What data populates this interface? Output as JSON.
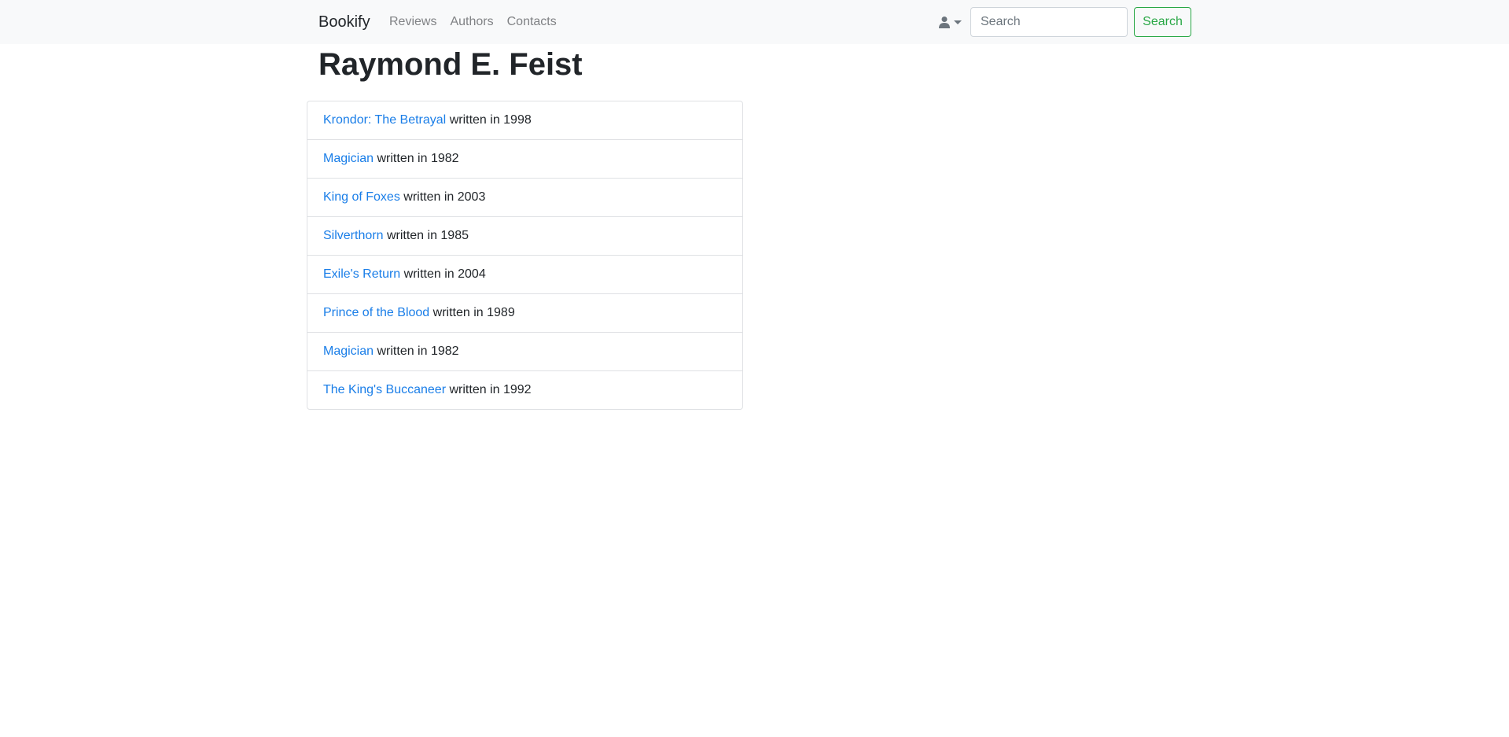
{
  "navbar": {
    "brand": "Bookify",
    "links": [
      "Reviews",
      "Authors",
      "Contacts"
    ],
    "user_icon": "user-icon",
    "search": {
      "placeholder": "Search",
      "value": "",
      "button_label": "Search"
    }
  },
  "author": {
    "name": "Raymond E. Feist"
  },
  "books": [
    {
      "title": "Krondor: The Betrayal",
      "year_text": "written in 1998"
    },
    {
      "title": "Magician",
      "year_text": "written in 1982"
    },
    {
      "title": "King of Foxes",
      "year_text": "written in 2003"
    },
    {
      "title": "Silverthorn",
      "year_text": "written in 1985"
    },
    {
      "title": "Exile's Return",
      "year_text": "written in 2004"
    },
    {
      "title": "Prince of the Blood",
      "year_text": "written in 1989"
    },
    {
      "title": "Magician",
      "year_text": "written in 1982"
    },
    {
      "title": "The King's Buccaneer",
      "year_text": "written in 1992"
    }
  ],
  "colors": {
    "navbar_bg": "#f8f9fa",
    "link": "#1a7ee8",
    "nav_link": "#808285",
    "success": "#28a745"
  }
}
